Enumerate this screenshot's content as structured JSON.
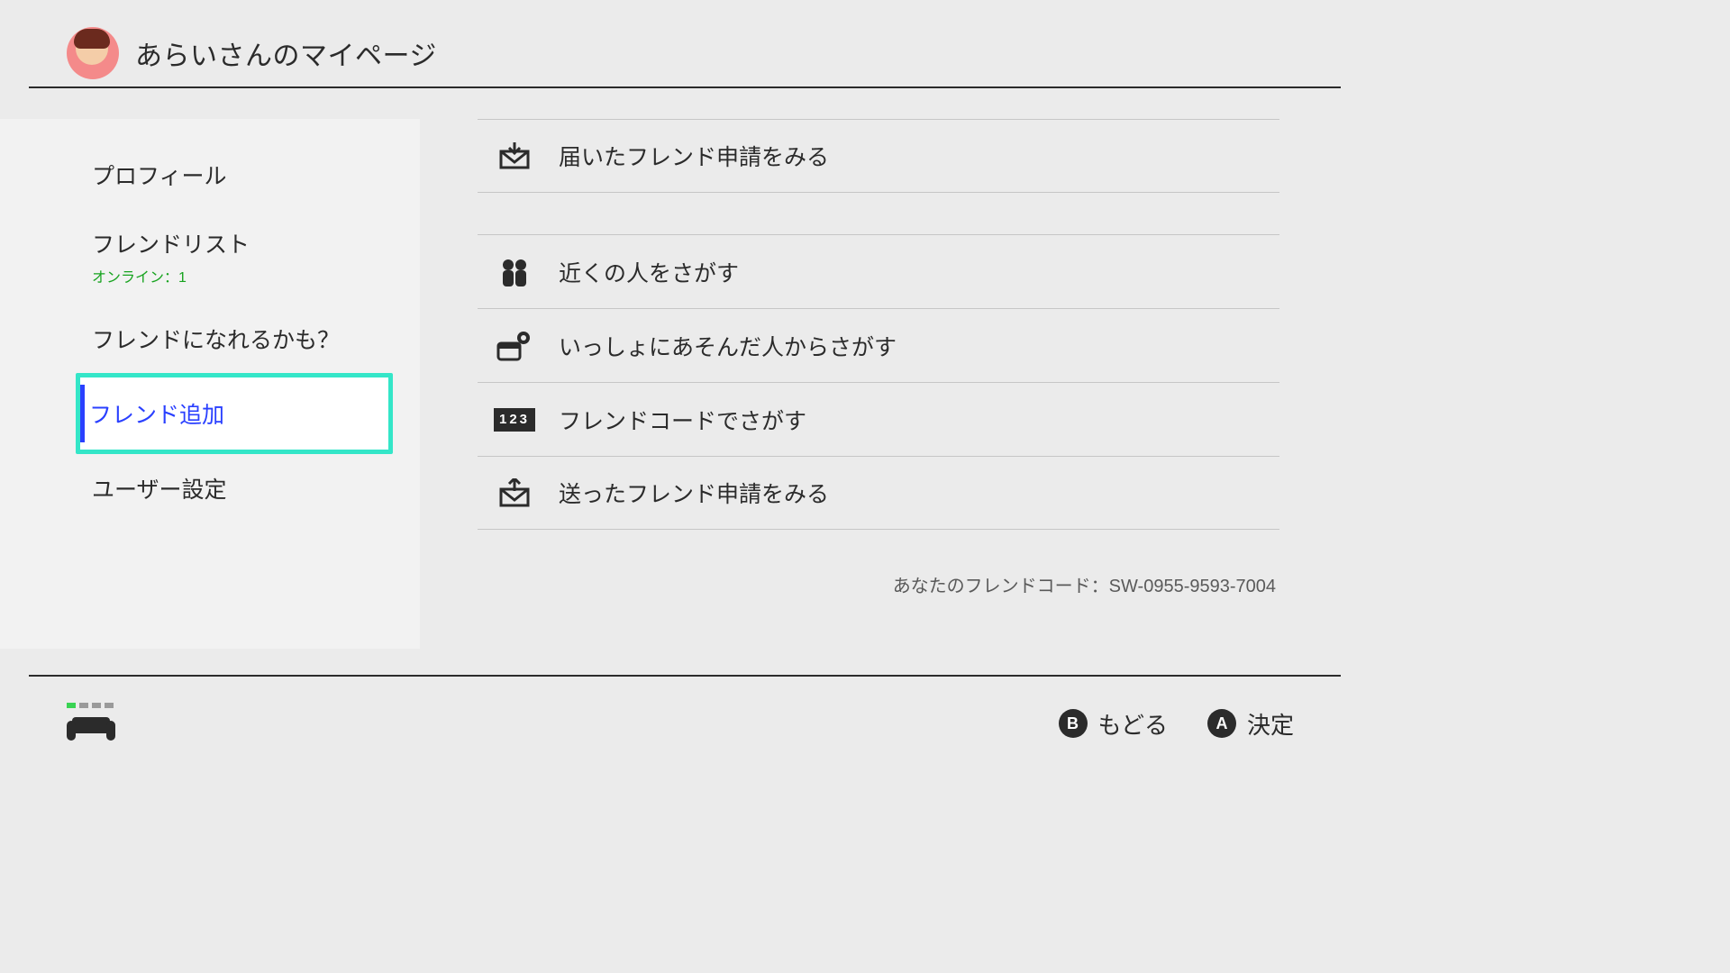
{
  "header": {
    "title": "あらいさんのマイページ"
  },
  "sidebar": {
    "items": [
      {
        "label": "プロフィール"
      },
      {
        "label": "フレンドリスト",
        "sublabel": "オンライン：1"
      },
      {
        "label": "フレンドになれるかも？"
      },
      {
        "label": "フレンド追加",
        "selected": true
      },
      {
        "label": "ユーザー設定"
      }
    ]
  },
  "main": {
    "group1": [
      {
        "icon": "inbox",
        "label": "届いたフレンド申請をみる"
      }
    ],
    "group2": [
      {
        "icon": "people",
        "label": "近くの人をさがす"
      },
      {
        "icon": "played",
        "label": "いっしょにあそんだ人からさがす"
      },
      {
        "icon": "code",
        "label": "フレンドコードでさがす",
        "code_text": "123"
      },
      {
        "icon": "outbox",
        "label": "送ったフレンド申請をみる"
      }
    ],
    "friend_code_label": "あなたのフレンドコード：SW-0955-9593-7004"
  },
  "footer": {
    "b_label": "もどる",
    "a_label": "決定",
    "b_glyph": "B",
    "a_glyph": "A"
  }
}
